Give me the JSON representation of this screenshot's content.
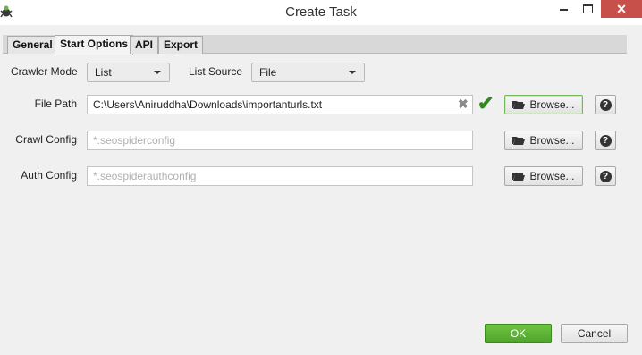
{
  "window": {
    "title": "Create Task",
    "close_glyph": "✕"
  },
  "tabs": [
    {
      "label": "General",
      "active": false
    },
    {
      "label": "Start Options",
      "active": true
    },
    {
      "label": "API",
      "active": false
    },
    {
      "label": "Export",
      "active": false
    }
  ],
  "crawler_mode": {
    "label": "Crawler Mode",
    "value": "List"
  },
  "list_source": {
    "label": "List Source",
    "value": "File"
  },
  "file_path": {
    "label": "File Path",
    "value": "C:\\Users\\Aniruddha\\Downloads\\importanturls.txt",
    "clear_glyph": "✖",
    "valid_glyph": "✔",
    "browse_label": "Browse..."
  },
  "crawl_config": {
    "label": "Crawl Config",
    "placeholder": "*.seospiderconfig",
    "browse_label": "Browse..."
  },
  "auth_config": {
    "label": "Auth Config",
    "placeholder": "*.seospiderauthconfig",
    "browse_label": "Browse..."
  },
  "help_glyph": "?",
  "footer": {
    "ok_label": "OK",
    "cancel_label": "Cancel"
  },
  "colors": {
    "ok_green": "#5cb535",
    "close_red": "#c7504a",
    "valid_green": "#2e8b1a"
  }
}
